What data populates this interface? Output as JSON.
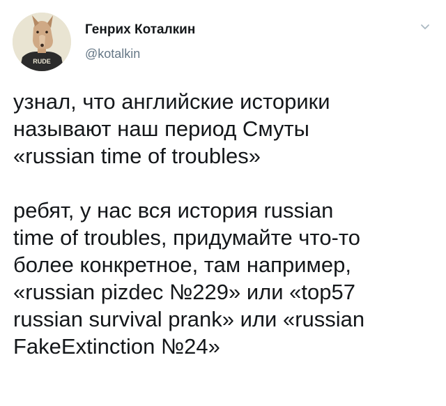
{
  "author": {
    "display_name": "Генрих Коталкин",
    "handle": "@kotalkin",
    "avatar_icon": "dog-avatar-icon",
    "avatar_shirt_text": "RUDE"
  },
  "menu": {
    "icon": "chevron-down-icon"
  },
  "tweet": {
    "paragraph_1": {
      "line_1": "узнал, что английские историки",
      "line_2": "называют наш период Смуты",
      "line_3": "«russian time of troubles»"
    },
    "paragraph_2": {
      "line_1": "ребят, у нас вся история russian",
      "line_2": "time of troubles, придумайте что-то",
      "line_3": "более конкретное, там например,",
      "line_4": "«russian pizdec №229» или «top57",
      "line_5": "russian survival prank» или «russian",
      "line_6": "FakeExtinction №24»"
    }
  },
  "colors": {
    "text": "#14171a",
    "secondary": "#657786",
    "background": "#ffffff"
  }
}
